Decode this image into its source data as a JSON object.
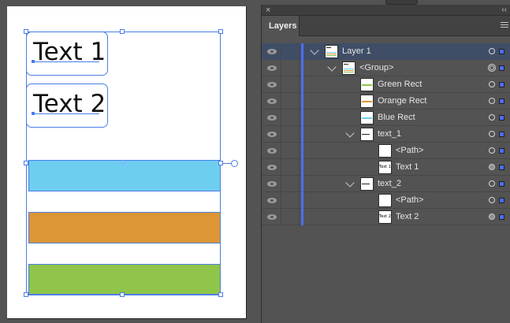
{
  "canvas": {
    "text_frames": [
      {
        "content": "Text 1"
      },
      {
        "content": "Text 2"
      }
    ],
    "rects": [
      {
        "name": "Blue Rect",
        "color": "#6ecef0"
      },
      {
        "name": "Orange Rect",
        "color": "#dc9636"
      },
      {
        "name": "Green Rect",
        "color": "#8ec54a"
      }
    ]
  },
  "panel": {
    "close_glyph": "×",
    "collapse_glyph": "‹‹",
    "tab_label": "Layers",
    "accent_color": "#4d6ef5",
    "rows": [
      {
        "label": "Layer 1",
        "depth": 0,
        "expanded": true,
        "selected": true,
        "thumb": "layer",
        "target": "open"
      },
      {
        "label": "<Group>",
        "depth": 1,
        "expanded": true,
        "selected": false,
        "thumb": "group",
        "target": "double"
      },
      {
        "label": "Green Rect",
        "depth": 2,
        "expanded": null,
        "selected": false,
        "thumb": "green",
        "target": "open"
      },
      {
        "label": "Orange Rect",
        "depth": 2,
        "expanded": null,
        "selected": false,
        "thumb": "orange",
        "target": "open"
      },
      {
        "label": "Blue Rect",
        "depth": 2,
        "expanded": null,
        "selected": false,
        "thumb": "blue",
        "target": "open"
      },
      {
        "label": "text_1",
        "depth": 2,
        "expanded": true,
        "selected": false,
        "thumb": "text",
        "target": "open"
      },
      {
        "label": "<Path>",
        "depth": 3,
        "expanded": null,
        "selected": false,
        "thumb": "blank",
        "target": "open"
      },
      {
        "label": "Text 1",
        "depth": 3,
        "expanded": null,
        "selected": false,
        "thumb": "Text 1",
        "target": "filled"
      },
      {
        "label": "text_2",
        "depth": 2,
        "expanded": true,
        "selected": false,
        "thumb": "text",
        "target": "open"
      },
      {
        "label": "<Path>",
        "depth": 3,
        "expanded": null,
        "selected": false,
        "thumb": "blank",
        "target": "open"
      },
      {
        "label": "Text 2",
        "depth": 3,
        "expanded": null,
        "selected": false,
        "thumb": "Text 2",
        "target": "filled"
      }
    ]
  }
}
